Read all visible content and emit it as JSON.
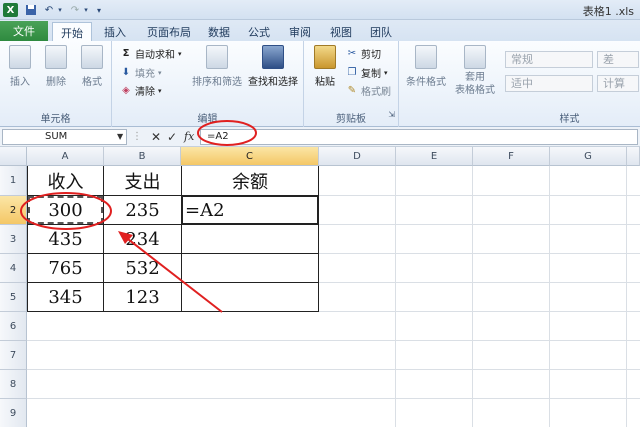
{
  "titlebar": {
    "app_icon": "X",
    "title": "表格1 .xls"
  },
  "tabs": [
    {
      "label": "文件"
    },
    {
      "label": "开始"
    },
    {
      "label": "插入"
    },
    {
      "label": "页面布局"
    },
    {
      "label": "数据"
    },
    {
      "label": "公式"
    },
    {
      "label": "审阅"
    },
    {
      "label": "视图"
    },
    {
      "label": "团队"
    }
  ],
  "ribbon": {
    "cells_group": {
      "insert": "插入",
      "delete": "删除",
      "format": "格式",
      "label": "单元格"
    },
    "editing_group": {
      "autosum": "自动求和",
      "fill": "填充",
      "clear": "清除",
      "sort_filter": "排序和筛选",
      "find_select": "查找和选择",
      "label": "编辑"
    },
    "clipboard_group": {
      "paste": "粘贴",
      "cut": "剪切",
      "copy": "复制",
      "format_painter": "格式刷",
      "label": "剪贴板"
    },
    "styles_group": {
      "conditional_format": "条件格式",
      "table_format": "套用\n表格格式",
      "normal": "常规",
      "bad": "差",
      "neutral": "适中",
      "calculation": "计算",
      "label": "样式"
    }
  },
  "formula_bar": {
    "name_box": "SUM",
    "cancel": "✕",
    "enter": "✓",
    "fx": "fx",
    "formula": "=A2"
  },
  "columns": [
    "A",
    "B",
    "C",
    "D",
    "E",
    "F",
    "G"
  ],
  "rows": [
    "1",
    "2",
    "3",
    "4",
    "5",
    "6",
    "7",
    "8",
    "9"
  ],
  "table": {
    "headers": [
      "收入",
      "支出",
      "余额"
    ],
    "rows": [
      [
        "300",
        "235",
        "=A2"
      ],
      [
        "435",
        "234",
        ""
      ],
      [
        "765",
        "532",
        ""
      ],
      [
        "345",
        "123",
        ""
      ]
    ]
  },
  "annotation_color": "#e02020"
}
